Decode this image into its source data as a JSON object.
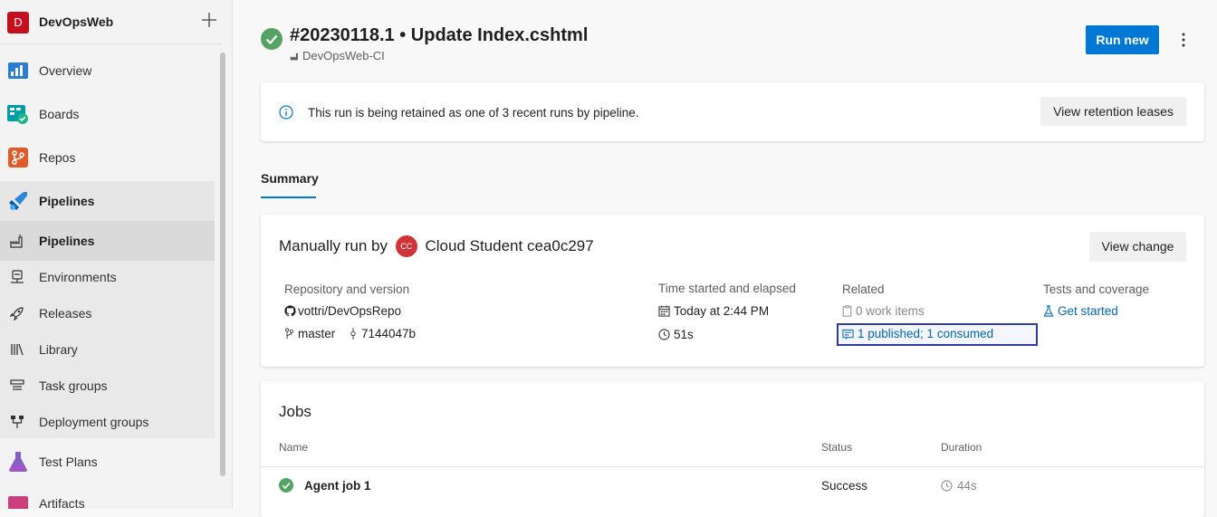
{
  "sidebar": {
    "org": {
      "avatar_letter": "D",
      "name": "DevOpsWeb"
    },
    "items": [
      {
        "label": "Overview",
        "icon": "overview-icon"
      },
      {
        "label": "Boards",
        "icon": "boards-icon"
      },
      {
        "label": "Repos",
        "icon": "repos-icon"
      },
      {
        "label": "Pipelines",
        "icon": "pipelines-icon"
      },
      {
        "label": "Pipelines",
        "icon": "pipelines-sub-icon"
      },
      {
        "label": "Environments",
        "icon": "environments-icon"
      },
      {
        "label": "Releases",
        "icon": "rocket-icon"
      },
      {
        "label": "Library",
        "icon": "library-icon"
      },
      {
        "label": "Task groups",
        "icon": "task-groups-icon"
      },
      {
        "label": "Deployment groups",
        "icon": "deployment-groups-icon"
      },
      {
        "label": "Test Plans",
        "icon": "test-plans-icon"
      },
      {
        "label": "Artifacts",
        "icon": "artifacts-icon"
      }
    ]
  },
  "header": {
    "title": "#20230118.1 • Update Index.cshtml",
    "pipeline": "DevOpsWeb-CI",
    "run_new_label": "Run new",
    "status": "success"
  },
  "retention": {
    "message": "This run is being retained as one of 3 recent runs by pipeline.",
    "button_label": "View retention leases"
  },
  "tabs": [
    {
      "label": "Summary",
      "active": true
    }
  ],
  "summary": {
    "prefix": "Manually run by",
    "avatar_initials": "CC",
    "user": "Cloud Student",
    "commit_suffix": "cea0c297",
    "view_change_label": "View change",
    "repo": {
      "header": "Repository and version",
      "name": "vottri/DevOpsRepo",
      "branch": "master",
      "commit": "7144047b"
    },
    "time": {
      "header": "Time started and elapsed",
      "started": "Today at 2:44 PM",
      "elapsed": "51s"
    },
    "related": {
      "header": "Related",
      "work_items": "0 work items",
      "artifacts": "1 published; 1 consumed"
    },
    "tests": {
      "header": "Tests and coverage",
      "link": "Get started"
    }
  },
  "jobs": {
    "title": "Jobs",
    "columns": [
      "Name",
      "Status",
      "Duration"
    ],
    "rows": [
      {
        "name": "Agent job 1",
        "status": "Success",
        "duration": "44s"
      }
    ]
  },
  "colors": {
    "accent": "#0078d4",
    "success": "#55a362",
    "org_avatar": "#c50f1f",
    "user_avatar": "#d13438",
    "focus_outline": "#2e3ca3"
  }
}
